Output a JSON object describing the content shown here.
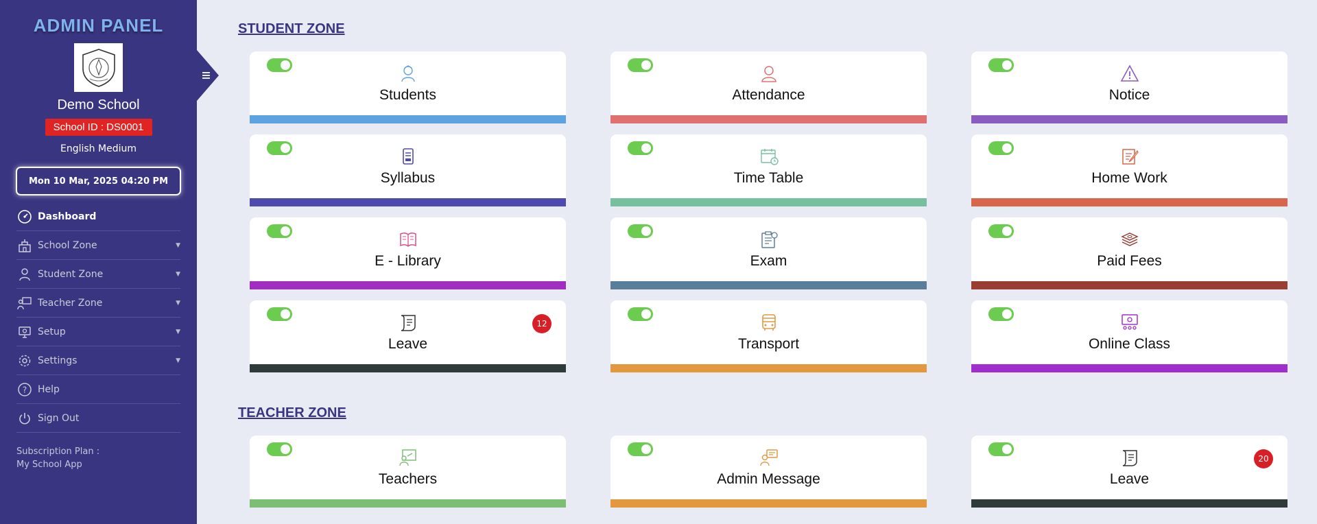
{
  "sidebar": {
    "brand": "ADMIN PANEL",
    "school_name": "Demo School",
    "school_id": "School ID : DS0001",
    "medium": "English Medium",
    "datetime": "Mon 10 Mar, 2025 04:20 PM",
    "nav": [
      {
        "label": "Dashboard",
        "icon": "dashboard-icon"
      },
      {
        "label": "School Zone",
        "icon": "school-icon"
      },
      {
        "label": "Student Zone",
        "icon": "student-icon"
      },
      {
        "label": "Teacher Zone",
        "icon": "teacher-icon"
      },
      {
        "label": "Setup",
        "icon": "setup-icon"
      },
      {
        "label": "Settings",
        "icon": "gear-icon"
      },
      {
        "label": "Help",
        "icon": "help-icon"
      },
      {
        "label": "Sign Out",
        "icon": "power-icon"
      }
    ],
    "subscription_label": "Subscription Plan :",
    "subscription_value": "My School App"
  },
  "student_zone": {
    "title": "STUDENT ZONE",
    "cards": [
      {
        "label": "Students",
        "icon": "student-icon",
        "color": "#5fa2e0"
      },
      {
        "label": "Attendance",
        "icon": "attendance-icon",
        "color": "#e07070"
      },
      {
        "label": "Notice",
        "icon": "notice-icon",
        "color": "#8a5cbf"
      },
      {
        "label": "Syllabus",
        "icon": "syllabus-icon",
        "color": "#4e4bb0"
      },
      {
        "label": "Time Table",
        "icon": "calendar-icon",
        "color": "#76c0a0"
      },
      {
        "label": "Home Work",
        "icon": "homework-icon",
        "color": "#d9654a"
      },
      {
        "label": "E - Library",
        "icon": "book-icon",
        "color": "#a02ec0"
      },
      {
        "label": "Exam",
        "icon": "exam-icon",
        "color": "#5a7d9a"
      },
      {
        "label": "Paid Fees",
        "icon": "money-icon",
        "color": "#9a3d33"
      },
      {
        "label": "Leave",
        "icon": "scroll-icon",
        "color": "#2f3b3a",
        "badge": "12"
      },
      {
        "label": "Transport",
        "icon": "bus-icon",
        "color": "#e39840"
      },
      {
        "label": "Online Class",
        "icon": "online-class-icon",
        "color": "#a02ecf"
      }
    ]
  },
  "teacher_zone": {
    "title": "TEACHER ZONE",
    "cards": [
      {
        "label": "Teachers",
        "icon": "teacher-board-icon",
        "color": "#7cbf74"
      },
      {
        "label": "Admin Message",
        "icon": "message-icon",
        "color": "#e39840"
      },
      {
        "label": "Leave",
        "icon": "scroll-icon",
        "color": "#2f3b3a",
        "badge": "20"
      }
    ]
  }
}
